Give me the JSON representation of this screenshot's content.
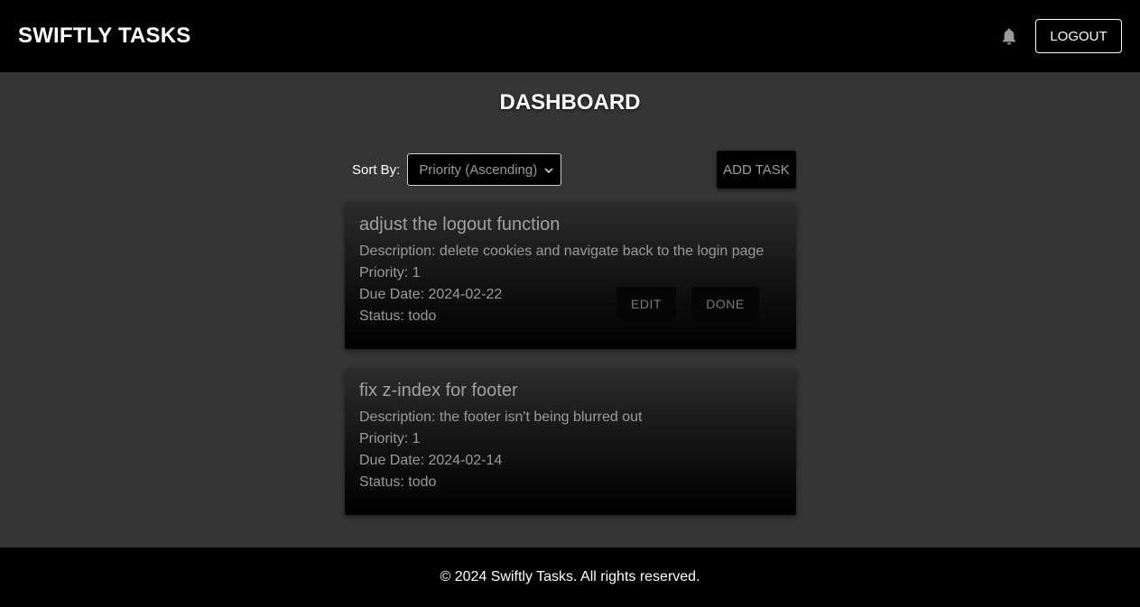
{
  "header": {
    "brand": "SWIFTLY TASKS",
    "logout_label": "LOGOUT",
    "notification_icon": "bell-icon"
  },
  "page": {
    "title": "DASHBOARD"
  },
  "toolbar": {
    "sort_label": "Sort By:",
    "sort_selected": "Priority (Ascending)",
    "add_task_label": "ADD TASK"
  },
  "tasks": [
    {
      "title": "adjust the logout function",
      "description": "Description: delete cookies and navigate back to the login page",
      "priority": "Priority: 1",
      "due_date": "Due Date: 2024-02-22",
      "status": "Status: todo",
      "edit_label": "EDIT",
      "done_label": "DONE"
    },
    {
      "title": "fix z-index for footer",
      "description": "Description: the footer isn't being blurred out",
      "priority": "Priority: 1",
      "due_date": "Due Date: 2024-02-14",
      "status": "Status: todo"
    }
  ],
  "footer": {
    "text": "© 2024 Swiftly Tasks. All rights reserved."
  },
  "colors": {
    "background": "#353535",
    "bars": "#000000",
    "text": "#ffffff",
    "muted_text": "#9a9a9a"
  }
}
